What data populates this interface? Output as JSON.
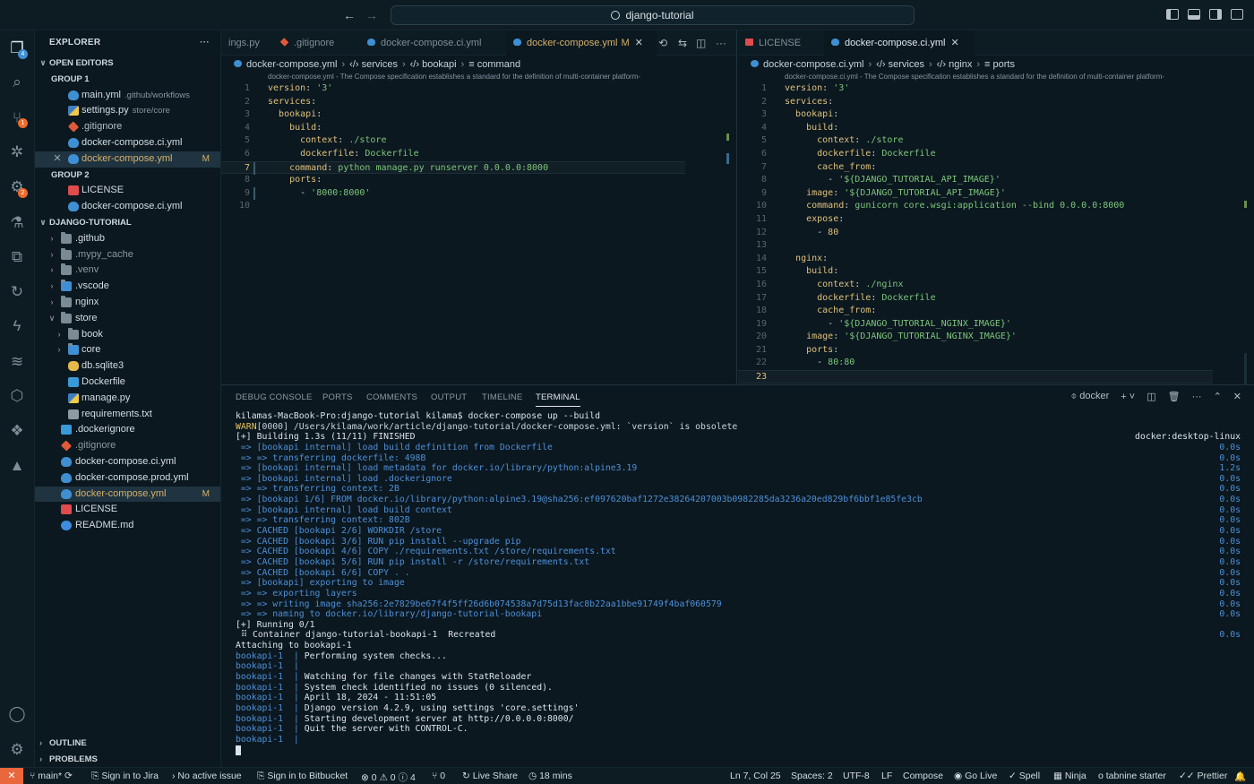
{
  "titlebar": {
    "search": "django-tutorial",
    "back": "←",
    "forward": "→"
  },
  "activity": {
    "scm_badge": "1",
    "extensions_badge": "2",
    "explorer_badge": "4"
  },
  "sidebar": {
    "title": "EXPLORER",
    "more": "···",
    "open_editors_label": "OPEN EDITORS",
    "group1_label": "GROUP 1",
    "group2_label": "GROUP 2",
    "group1": [
      {
        "name": "main.yml",
        "desc": ".github/workflows",
        "icon": "yml-icon"
      },
      {
        "name": "settings.py",
        "desc": "store/core",
        "icon": "python-icon"
      },
      {
        "name": ".gitignore",
        "desc": "",
        "icon": "git-icon"
      },
      {
        "name": "docker-compose.ci.yml",
        "desc": "",
        "icon": "yml-icon"
      },
      {
        "name": "docker-compose.yml",
        "desc": "",
        "icon": "yml-icon",
        "mod": "M"
      }
    ],
    "group2": [
      {
        "name": "LICENSE",
        "icon": "license-icon"
      },
      {
        "name": "docker-compose.ci.yml",
        "icon": "yml-icon"
      }
    ],
    "project_label": "DJANGO-TUTORIAL",
    "tree": [
      {
        "name": ".github"
      },
      {
        "name": ".mypy_cache"
      },
      {
        "name": ".venv"
      },
      {
        "name": ".vscode"
      },
      {
        "name": "nginx"
      },
      {
        "name": "store"
      },
      {
        "name": "book"
      },
      {
        "name": "core"
      },
      {
        "name": "db.sqlite3"
      },
      {
        "name": "Dockerfile"
      },
      {
        "name": "manage.py"
      },
      {
        "name": "requirements.txt"
      },
      {
        "name": ".dockerignore"
      },
      {
        "name": ".gitignore"
      },
      {
        "name": "docker-compose.ci.yml"
      },
      {
        "name": "docker-compose.prod.yml"
      },
      {
        "name": "docker-compose.yml",
        "mod": "M"
      },
      {
        "name": "LICENSE"
      },
      {
        "name": "README.md"
      }
    ],
    "outline_label": "OUTLINE",
    "problems_label": "PROBLEMS"
  },
  "editor_left": {
    "tabs": [
      {
        "label": "ings.py"
      },
      {
        "label": ".gitignore"
      },
      {
        "label": "docker-compose.ci.yml"
      },
      {
        "label": "docker-compose.yml",
        "mod": "M",
        "close": "✕"
      }
    ],
    "breadcrumb": [
      "docker-compose.yml",
      "services",
      "bookapi",
      "command"
    ],
    "schema_hint": "docker-compose.yml - The Compose specification establishes a standard for the definition of multi-container platform-",
    "line_numbers": [
      "1",
      "2",
      "3",
      "4",
      "5",
      "6",
      "7",
      "8",
      "9",
      "10"
    ],
    "lines": {
      "l1k": "version",
      "l1v": "'3'",
      "l2k": "services",
      "l3k": "bookapi",
      "l4k": "build",
      "l5k": "context",
      "l5v": "./store",
      "l6k": "dockerfile",
      "l6v": "Dockerfile",
      "l7k": "command",
      "l7v": "python manage.py runserver 0.0.0.0:8000",
      "l8k": "ports",
      "l9v": "'8000:8000'"
    }
  },
  "editor_right": {
    "tabs": [
      {
        "label": "LICENSE"
      },
      {
        "label": "docker-compose.ci.yml",
        "close": "✕"
      }
    ],
    "breadcrumb": [
      "docker-compose.ci.yml",
      "services",
      "nginx",
      "ports"
    ],
    "schema_hint": "docker-compose.ci.yml - The Compose specification establishes a standard for the definition of multi-container platform-",
    "line_numbers": [
      "1",
      "2",
      "3",
      "4",
      "5",
      "6",
      "7",
      "8",
      "9",
      "10",
      "11",
      "12",
      "13",
      "14",
      "15",
      "16",
      "17",
      "18",
      "19",
      "20",
      "21",
      "22",
      "23"
    ],
    "lines": {
      "l1k": "version",
      "l1v": "'3'",
      "l2k": "services",
      "l3k": "bookapi",
      "l4k": "build",
      "l5k": "context",
      "l5v": "./store",
      "l6k": "dockerfile",
      "l6v": "Dockerfile",
      "l7k": "cache_from",
      "l8v": "'${DJANGO_TUTORIAL_API_IMAGE}'",
      "l9k": "image",
      "l9v": "'${DJANGO_TUTORIAL_API_IMAGE}'",
      "l10k": "command",
      "l10v": "gunicorn core.wsgi:application --bind 0.0.0.0:8000",
      "l11k": "expose",
      "l12v": "80",
      "l14k": "nginx",
      "l15k": "build",
      "l16k": "context",
      "l16v": "./nginx",
      "l17k": "dockerfile",
      "l17v": "Dockerfile",
      "l18k": "cache_from",
      "l19v": "'${DJANGO_TUTORIAL_NGINX_IMAGE}'",
      "l20k": "image",
      "l20v": "'${DJANGO_TUTORIAL_NGINX_IMAGE}'",
      "l21k": "ports",
      "l22v": "80:80"
    }
  },
  "panel": {
    "tabs": [
      "DEBUG CONSOLE",
      "PORTS",
      "COMMENTS",
      "OUTPUT",
      "TIMELINE",
      "TERMINAL"
    ],
    "terminal_name": "docker",
    "terminal": [
      {
        "text": "kilamas-MacBook-Pro:django-tutorial kilama$ docker-compose up --build",
        "right": "",
        "cls": ""
      },
      {
        "text": "WARN[0000] /Users/kilama/work/article/django-tutorial/docker-compose.yml: `version` is obsolete",
        "right": "",
        "cls": "warn"
      },
      {
        "text": "[+] Building 1.3s (11/11) FINISHED",
        "right": "docker:desktop-linux",
        "cls": ""
      },
      {
        "text": " => [bookapi internal] load build definition from Dockerfile",
        "right": "0.0s",
        "cls": "blue"
      },
      {
        "text": " => => transferring dockerfile: 498B",
        "right": "0.0s",
        "cls": "blue"
      },
      {
        "text": " => [bookapi internal] load metadata for docker.io/library/python:alpine3.19",
        "right": "1.2s",
        "cls": "blue"
      },
      {
        "text": " => [bookapi internal] load .dockerignore",
        "right": "0.0s",
        "cls": "blue"
      },
      {
        "text": " => => transferring context: 2B",
        "right": "0.0s",
        "cls": "blue"
      },
      {
        "text": " => [bookapi 1/6] FROM docker.io/library/python:alpine3.19@sha256:ef097620baf1272e38264207003b0982285da3236a20ed829bf6bbf1e85fe3cb",
        "right": "0.0s",
        "cls": "blue"
      },
      {
        "text": " => [bookapi internal] load build context",
        "right": "0.0s",
        "cls": "blue"
      },
      {
        "text": " => => transferring context: 802B",
        "right": "0.0s",
        "cls": "blue"
      },
      {
        "text": " => CACHED [bookapi 2/6] WORKDIR /store",
        "right": "0.0s",
        "cls": "blue"
      },
      {
        "text": " => CACHED [bookapi 3/6] RUN pip install --upgrade pip",
        "right": "0.0s",
        "cls": "blue"
      },
      {
        "text": " => CACHED [bookapi 4/6] COPY ./requirements.txt /store/requirements.txt",
        "right": "0.0s",
        "cls": "blue"
      },
      {
        "text": " => CACHED [bookapi 5/6] RUN pip install -r /store/requirements.txt",
        "right": "0.0s",
        "cls": "blue"
      },
      {
        "text": " => CACHED [bookapi 6/6] COPY . .",
        "right": "0.0s",
        "cls": "blue"
      },
      {
        "text": " => [bookapi] exporting to image",
        "right": "0.0s",
        "cls": "blue"
      },
      {
        "text": " => => exporting layers",
        "right": "0.0s",
        "cls": "blue"
      },
      {
        "text": " => => writing image sha256:2e7829be67f4f5ff26d6b074538a7d75d13fac8b22aa1bbe91749f4baf060579",
        "right": "0.0s",
        "cls": "blue"
      },
      {
        "text": " => => naming to docker.io/library/django-tutorial-bookapi",
        "right": "0.0s",
        "cls": "blue"
      },
      {
        "text": "[+] Running 0/1",
        "right": "",
        "cls": ""
      },
      {
        "text": " ⠿ Container django-tutorial-bookapi-1  Recreated",
        "right": "0.0s",
        "cls": ""
      },
      {
        "text": "Attaching to bookapi-1",
        "right": "",
        "cls": ""
      },
      {
        "text": "bookapi-1  | Performing system checks...",
        "right": "",
        "cls": "log"
      },
      {
        "text": "bookapi-1  |",
        "right": "",
        "cls": "log"
      },
      {
        "text": "bookapi-1  | Watching for file changes with StatReloader",
        "right": "",
        "cls": "log"
      },
      {
        "text": "bookapi-1  | System check identified no issues (0 silenced).",
        "right": "",
        "cls": "log"
      },
      {
        "text": "bookapi-1  | April 18, 2024 - 11:51:05",
        "right": "",
        "cls": "log"
      },
      {
        "text": "bookapi-1  | Django version 4.2.9, using settings 'core.settings'",
        "right": "",
        "cls": "log"
      },
      {
        "text": "bookapi-1  | Starting development server at http://0.0.0.0:8000/",
        "right": "",
        "cls": "log"
      },
      {
        "text": "bookapi-1  | Quit the server with CONTROL-C.",
        "right": "",
        "cls": "log"
      },
      {
        "text": "bookapi-1  |",
        "right": "",
        "cls": "log"
      }
    ]
  },
  "status": {
    "remote": "✕",
    "branch": "main*",
    "jira": "Sign in to Jira",
    "issue": "No active issue",
    "bitbucket": "Sign in to Bitbucket",
    "problems": "⊗ 0 ⚠ 0 ⓘ 4",
    "ports": "⑂ 0",
    "liveshare": "Live Share",
    "time": "18 mins",
    "position": "Ln 7, Col 25",
    "spaces": "Spaces: 2",
    "encoding": "UTF-8",
    "eol": "LF",
    "language": "Compose",
    "golive": "Go Live",
    "spell": "Spell",
    "ninja": "Ninja",
    "tabnine": "tabnine starter",
    "prettier": "Prettier"
  }
}
